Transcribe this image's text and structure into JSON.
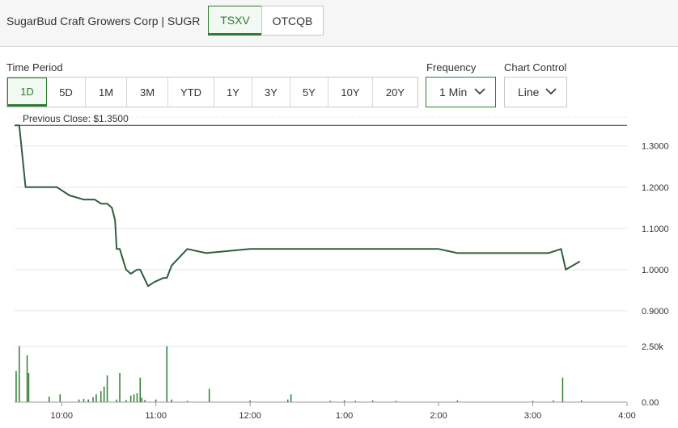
{
  "header": {
    "company": "SugarBud Craft Growers Corp | SUGR",
    "exchanges": [
      "TSXV",
      "OTCQB"
    ],
    "active_exchange": "TSXV"
  },
  "controls": {
    "time_period_label": "Time Period",
    "periods": [
      "1D",
      "5D",
      "1M",
      "3M",
      "YTD",
      "1Y",
      "3Y",
      "5Y",
      "10Y",
      "20Y"
    ],
    "active_period": "1D",
    "frequency_label": "Frequency",
    "frequency_value": "1 Min",
    "chart_control_label": "Chart Control",
    "chart_control_value": "Line"
  },
  "colors": {
    "accent": "#2e7d32",
    "line": "#2f5e3e",
    "volume": "#2e7d32"
  },
  "chart_data": {
    "type": "line",
    "annotation": "Previous Close: $1.3500",
    "previous_close": 1.35,
    "x_ticks": [
      "10:00",
      "11:00",
      "12:00",
      "1:00",
      "2:00",
      "3:00",
      "4:00"
    ],
    "price_ticks": [
      "1.3000",
      "1.2000",
      "1.1000",
      "1.0000",
      "0.9000"
    ],
    "volume_ticks": [
      "2.50k",
      "0.00"
    ],
    "ylim": [
      0.89,
      1.37
    ],
    "volume_ylim": [
      0,
      3000
    ],
    "price": {
      "x": [
        "9:30",
        "9:33",
        "9:37",
        "9:57",
        "10:05",
        "10:14",
        "10:21",
        "10:25",
        "10:29",
        "10:32",
        "10:34",
        "10:35",
        "10:37",
        "10:41",
        "10:44",
        "10:48",
        "10:50",
        "10:55",
        "10:59",
        "11:05",
        "11:07",
        "11:10",
        "11:20",
        "11:32",
        "12:00",
        "12:30",
        "1:00",
        "1:30",
        "2:00",
        "2:12",
        "2:30",
        "3:00",
        "3:10",
        "3:18",
        "3:21",
        "3:30"
      ],
      "y": [
        1.35,
        1.35,
        1.2,
        1.2,
        1.18,
        1.17,
        1.17,
        1.16,
        1.16,
        1.15,
        1.12,
        1.05,
        1.05,
        1.0,
        0.99,
        1.0,
        1.0,
        0.96,
        0.97,
        0.98,
        0.98,
        1.01,
        1.05,
        1.04,
        1.05,
        1.05,
        1.05,
        1.05,
        1.05,
        1.04,
        1.04,
        1.04,
        1.04,
        1.05,
        1.0,
        1.02
      ]
    },
    "volume": {
      "x": [
        "9:31",
        "9:33",
        "9:38",
        "9:39",
        "9:52",
        "9:59",
        "10:11",
        "10:14",
        "10:17",
        "10:20",
        "10:22",
        "10:25",
        "10:27",
        "10:29",
        "10:35",
        "10:37",
        "10:41",
        "10:44",
        "10:46",
        "10:48",
        "10:50",
        "10:51",
        "10:53",
        "11:00",
        "11:07",
        "11:10",
        "11:20",
        "11:34",
        "12:00",
        "12:24",
        "12:26",
        "12:51",
        "1:00",
        "1:07",
        "1:18",
        "1:33",
        "2:12",
        "3:00",
        "3:13",
        "3:19",
        "3:31"
      ],
      "y": [
        1400,
        2500,
        2100,
        1300,
        250,
        350,
        120,
        150,
        120,
        220,
        350,
        500,
        700,
        1200,
        120,
        1300,
        100,
        300,
        350,
        400,
        1100,
        200,
        100,
        120,
        2500,
        120,
        60,
        600,
        80,
        120,
        350,
        60,
        80,
        60,
        80,
        60,
        80,
        60,
        80,
        1100,
        80
      ]
    }
  }
}
